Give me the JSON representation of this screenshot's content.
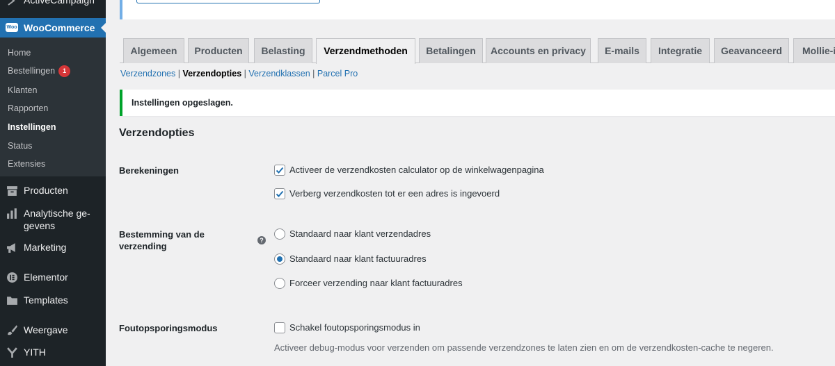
{
  "sidebar": {
    "top_item": "ActiveCampaign",
    "active_menu": "WooCommerce",
    "submenu": [
      {
        "label": "Home"
      },
      {
        "label": "Bestellingen",
        "badge": "1"
      },
      {
        "label": "Klanten"
      },
      {
        "label": "Rapporten"
      },
      {
        "label": "Instellingen"
      },
      {
        "label": "Status"
      },
      {
        "label": "Extensies"
      }
    ],
    "menu": [
      {
        "label": "Producten",
        "icon": "archive-icon"
      },
      {
        "label": "Analytische ge-\ngevens",
        "icon": "bar-chart-icon"
      },
      {
        "label": "Marketing",
        "icon": "megaphone-icon"
      },
      {
        "label": "Elementor",
        "icon": "elementor-icon"
      },
      {
        "label": "Templates",
        "icon": "folder-icon"
      },
      {
        "label": "Weergave",
        "icon": "brush-icon"
      },
      {
        "label": "YITH",
        "icon": "yith-icon"
      }
    ]
  },
  "tabs": [
    "Algemeen",
    "Producten",
    "Belasting",
    "Verzendmethoden",
    "Betalingen",
    "Accounts en privacy",
    "E-mails",
    "Integratie",
    "Geavanceerd",
    "Mollie-i"
  ],
  "subsubsub": {
    "items": [
      "Verzendzones",
      "Verzendopties",
      "Verzendklassen",
      "Parcel Pro"
    ]
  },
  "notice": "Instellingen opgeslagen.",
  "section_title": "Verzendopties",
  "settings": {
    "calculations": {
      "label": "Berekeningen",
      "options": [
        {
          "text": "Activeer de verzendkosten calculator op de winkelwagenpagina",
          "checked": true
        },
        {
          "text": "Verberg verzendkosten tot er een adres is ingevoerd",
          "checked": true
        }
      ]
    },
    "destination": {
      "label": "Bestemming van de verzending",
      "options": [
        {
          "text": "Standaard naar klant verzendadres",
          "selected": false
        },
        {
          "text": "Standaard naar klant factuuradres",
          "selected": true
        },
        {
          "text": "Forceer verzending naar klant factuuradres",
          "selected": false
        }
      ]
    },
    "debug": {
      "label": "Foutopsporingsmodus",
      "option": {
        "text": "Schakel foutopsporingsmodus in",
        "checked": false
      },
      "description": "Activeer debug-modus voor verzenden om passende verzendzones te laten zien en om de verzendkosten-cache te negeren."
    }
  },
  "colors": {
    "accent": "#2271b1",
    "sidebar": "#1d2327",
    "success": "#00a32a",
    "badge": "#d63638"
  }
}
